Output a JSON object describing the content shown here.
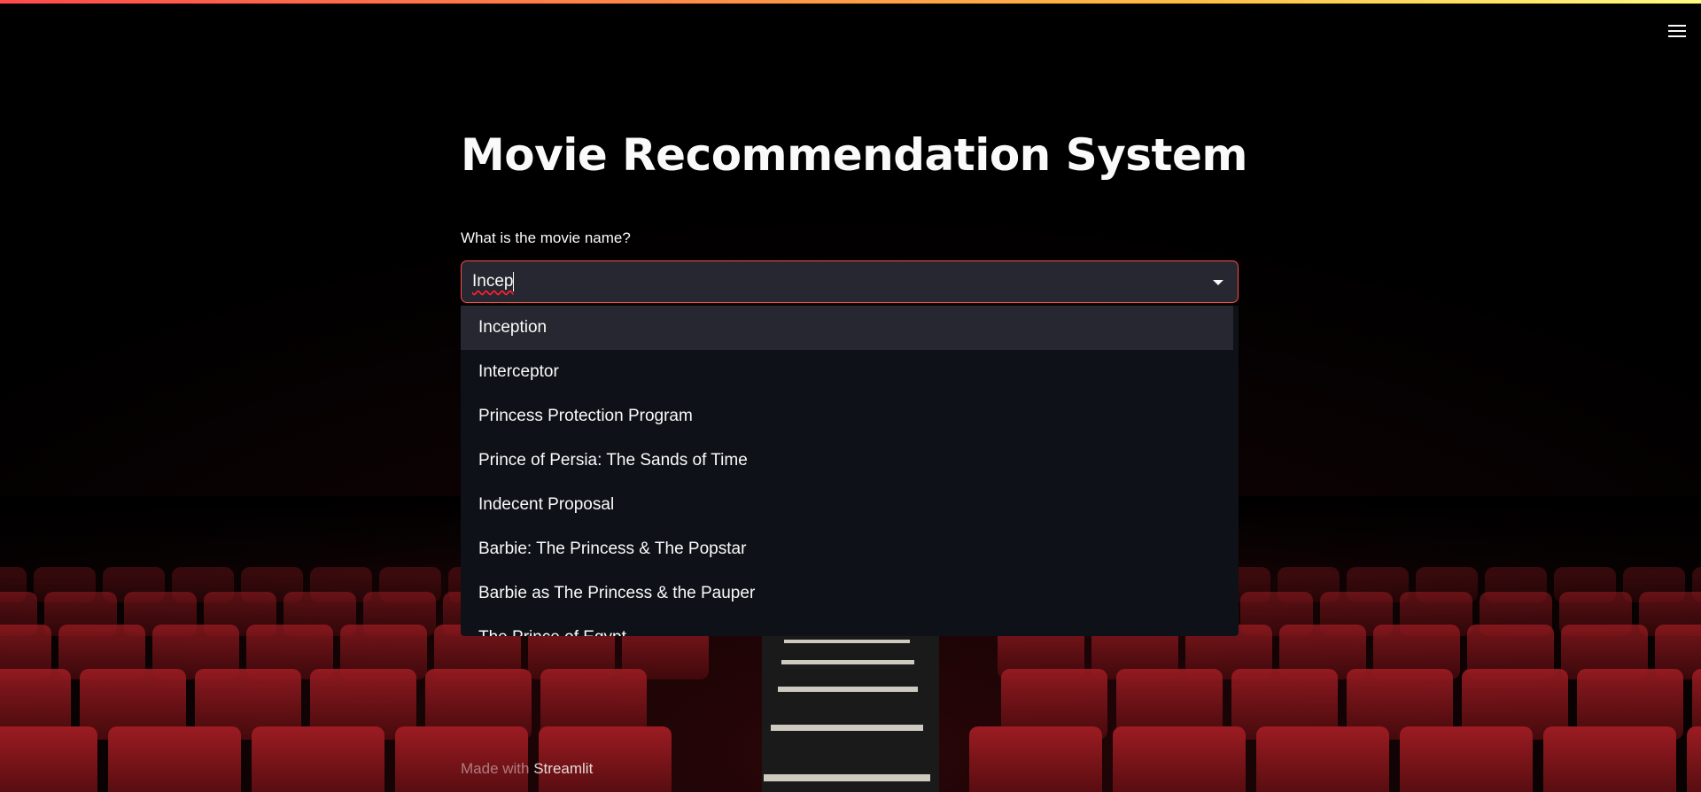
{
  "header": {
    "accent_gradient": [
      "#ff4b4b",
      "#ffbd45",
      "#fffd80"
    ],
    "menu_icon": "hamburger-menu-icon"
  },
  "main": {
    "title": "Movie Recommendation System",
    "select": {
      "label": "What is the movie name?",
      "value": "Incep",
      "border_color": "#ff4b4b",
      "icon": "chevron-down-icon"
    },
    "options": [
      "Inception",
      "Interceptor",
      "Princess Protection Program",
      "Prince of Persia: The Sands of Time",
      "Indecent Proposal",
      "Barbie: The Princess & The Popstar",
      "Barbie as The Princess & the Pauper",
      "The Prince of Egypt"
    ],
    "highlighted_option": "Inception"
  },
  "footer": {
    "prefix": "Made with",
    "brand": "Streamlit"
  },
  "background": {
    "seat_color": "#7a1218",
    "description_colors": [
      "#000000",
      "#7a1218"
    ]
  }
}
